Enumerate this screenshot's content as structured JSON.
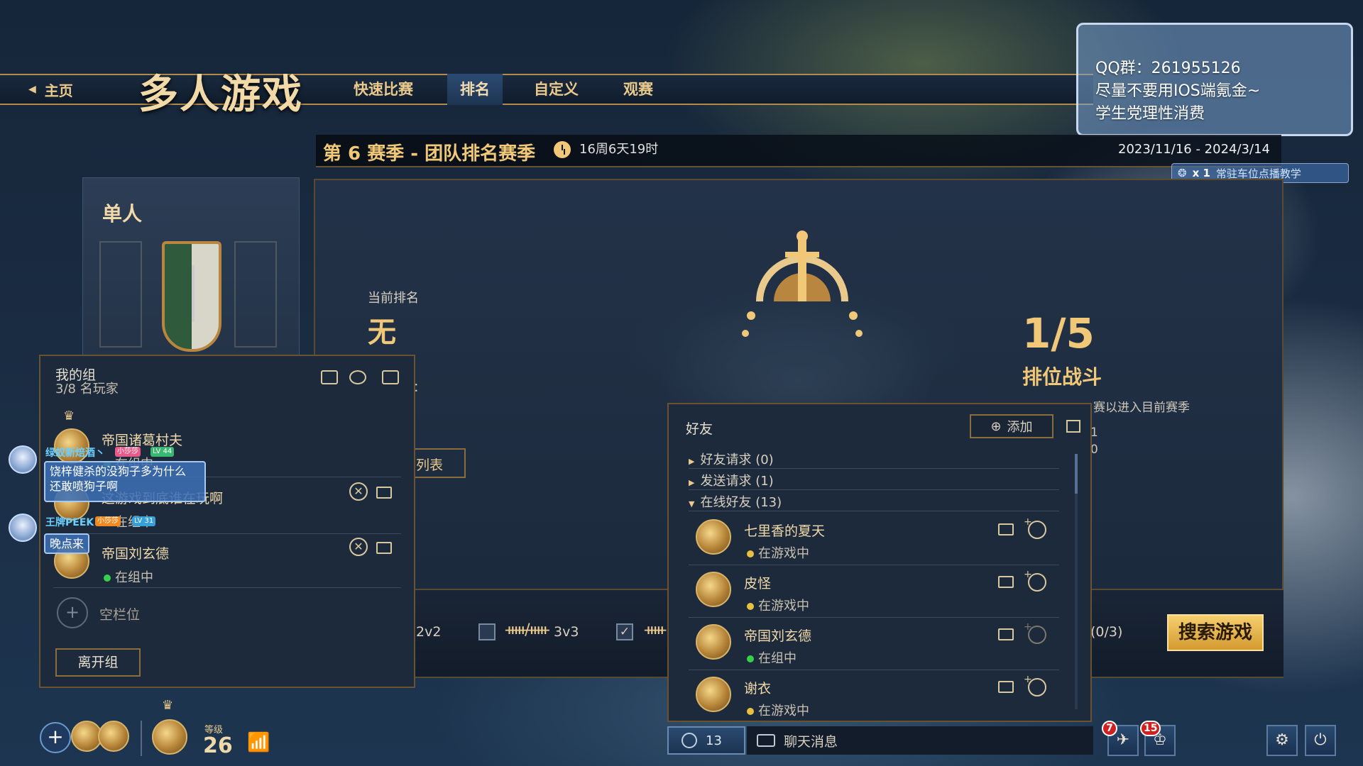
{
  "nav": {
    "home_label": "主页",
    "title": "多人游戏",
    "tabs": [
      {
        "label": "快速比赛",
        "active": false
      },
      {
        "label": "排名",
        "active": true
      },
      {
        "label": "自定义",
        "active": false
      },
      {
        "label": "观赛",
        "active": false
      }
    ]
  },
  "notice": {
    "lines": [
      "QQ群：261955126",
      "尽量不要用IOS端氪金~",
      "学生党理性消费"
    ],
    "bar_multiplier": "x 1",
    "bar_text": "常驻车位点播教学"
  },
  "season": {
    "title": "第 6 赛季 - 团队排名赛季",
    "countdown": "16周6天19时",
    "dates": "2023/11/16 - 2024/3/14"
  },
  "single": {
    "label": "单人"
  },
  "rank": {
    "current_label": "当前排名",
    "current_value": "无",
    "progress": "1/5",
    "battle_label": "排位战斗",
    "hint": "赛以进入目前赛季",
    "hint_nums": [
      "1",
      "0"
    ],
    "list_button": "列表",
    "colon_fragment": "："
  },
  "modes": {
    "m2v2": "2v2",
    "m3v3": "3v3",
    "invite_count": "(0/3)",
    "search_button": "搜索游戏"
  },
  "group": {
    "title": "我的组",
    "count": "3/8 名玩家",
    "members": [
      {
        "name": "帝国诸葛村夫",
        "status": "在组中",
        "dot": "green"
      },
      {
        "name": "这游戏到底谁在玩啊",
        "status": "在组中",
        "dot": "green"
      },
      {
        "name": "帝国刘玄德",
        "status": "在组中",
        "dot": "green"
      }
    ],
    "empty_slot": "空栏位",
    "leave_button": "离开组"
  },
  "live_chat": [
    {
      "user": "绿蚁新焙酒丶",
      "badge1": "小莎莎",
      "badge2": "LV 44",
      "message": "饶梓健杀的没狗子多为什么\n还敢喷狗子啊"
    },
    {
      "user": "王牌PEEK",
      "badge1": "小莎莎",
      "badge2": "LV 31",
      "message": "晚点来"
    }
  ],
  "friends": {
    "title": "好友",
    "add_button": "添加",
    "sections": [
      {
        "label": "好友请求 (0)",
        "expanded": false
      },
      {
        "label": "发送请求 (1)",
        "expanded": false
      },
      {
        "label": "在线好友 (13)",
        "expanded": true
      }
    ],
    "list": [
      {
        "name": "七里香的夏天",
        "status": "在游戏中",
        "dot": "yellow"
      },
      {
        "name": "皮怪",
        "status": "在游戏中",
        "dot": "yellow"
      },
      {
        "name": "帝国刘玄德",
        "status": "在组中",
        "dot": "green"
      },
      {
        "name": "谢衣",
        "status": "在游戏中",
        "dot": "yellow"
      }
    ]
  },
  "bottom": {
    "friend_count": "13",
    "chat_label": "聊天消息",
    "level_label": "等级",
    "level_value": "26",
    "badge_a": "7",
    "badge_b": "15"
  }
}
